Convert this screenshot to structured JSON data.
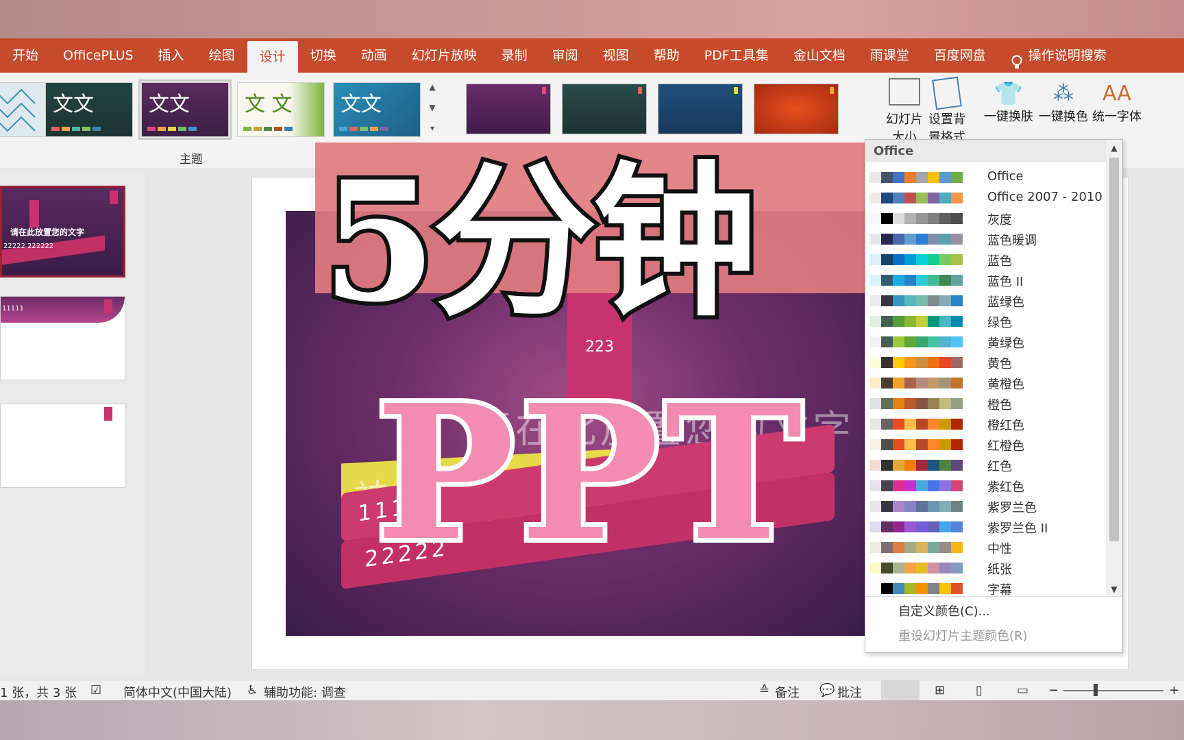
{
  "tabs": [
    "开始",
    "OfficePLUS",
    "插入",
    "绘图",
    "设计",
    "切换",
    "动画",
    "幻灯片放映",
    "录制",
    "审阅",
    "视图",
    "帮助",
    "PDF工具集",
    "金山文档",
    "雨课堂",
    "百度网盘"
  ],
  "active_tab": "设计",
  "tell_me": "操作说明搜索",
  "ribbon": {
    "theme_text": "文文",
    "theme_text_b": "文 文",
    "themes_group_label": "主题",
    "slide_size": "幻灯片大小",
    "format_bg": "设置背景格式",
    "one_click_skin": "一键换肤",
    "one_click_color": "一键换色",
    "unify_font": "统一字体"
  },
  "slide": {
    "pillar_text": "223",
    "title_text": "请在此放置您的文字",
    "yellow_text": "神州",
    "bar1_text": "1111",
    "bar2_text": "22222"
  },
  "thumbnails": {
    "t1_title": "请在此放置您的文字",
    "t1_sub": "22222 222222",
    "t2_text": "11111"
  },
  "overlay": {
    "headline": "5分钟",
    "ppt": "PPT"
  },
  "color_menu": {
    "header": "Office",
    "items": [
      {
        "name": "Office",
        "colors": [
          "#e8e8e8",
          "#44546a",
          "#4472c4",
          "#ed7d31",
          "#a5a5a5",
          "#ffc000",
          "#5b9bd5",
          "#70ad47"
        ]
      },
      {
        "name": "Office 2007 - 2010",
        "colors": [
          "#eeece1",
          "#1f497d",
          "#4f81bd",
          "#c0504d",
          "#9bbb59",
          "#8064a2",
          "#4bacc6",
          "#f79646"
        ]
      },
      {
        "name": "灰度",
        "colors": [
          "#f8f8f8",
          "#000000",
          "#dddddd",
          "#b2b2b2",
          "#969696",
          "#808080",
          "#5f5f5f",
          "#4d4d4d"
        ]
      },
      {
        "name": "蓝色暖调",
        "colors": [
          "#e7e6e6",
          "#242852",
          "#4a66ac",
          "#629dd1",
          "#297fd5",
          "#7f8fa9",
          "#5aa2ae",
          "#9d90a0"
        ]
      },
      {
        "name": "蓝色",
        "colors": [
          "#dbefF9",
          "#17406d",
          "#0f6fc6",
          "#009dd9",
          "#0bd0d9",
          "#10cf9b",
          "#7cca62",
          "#a5c249"
        ]
      },
      {
        "name": "蓝色 II",
        "colors": [
          "#dbf5f9",
          "#335b74",
          "#1cade4",
          "#2683c6",
          "#27ced7",
          "#42ba97",
          "#3e8853",
          "#62a39f"
        ]
      },
      {
        "name": "蓝绿色",
        "colors": [
          "#ebebeb",
          "#373545",
          "#3494ba",
          "#58b6c0",
          "#75bda7",
          "#7a8c8e",
          "#84acb6",
          "#2683c6"
        ]
      },
      {
        "name": "绿色",
        "colors": [
          "#e2efe2",
          "#455f51",
          "#549e39",
          "#8ab833",
          "#c0cf3a",
          "#029676",
          "#4ab5c4",
          "#0989b1"
        ]
      },
      {
        "name": "黄绿色",
        "colors": [
          "#f2f2f2",
          "#455f51",
          "#99cb38",
          "#63a537",
          "#37a76f",
          "#44c1a3",
          "#4eb3cf",
          "#51c3f9"
        ]
      },
      {
        "name": "黄色",
        "colors": [
          "#fffcdc",
          "#39302a",
          "#ffca08",
          "#f8931d",
          "#ce8d3e",
          "#ec7016",
          "#e64823",
          "#9c6a6a"
        ]
      },
      {
        "name": "黄橙色",
        "colors": [
          "#fbeec9",
          "#4e3b30",
          "#f0a22e",
          "#a5644e",
          "#b58b80",
          "#c3986d",
          "#a19574",
          "#c17529"
        ]
      },
      {
        "name": "橙色",
        "colors": [
          "#dfe3e5",
          "#637052",
          "#e48312",
          "#bd582c",
          "#865640",
          "#9b8357",
          "#c2bc80",
          "#94a088"
        ]
      },
      {
        "name": "橙红色",
        "colors": [
          "#e8e7e4",
          "#696464",
          "#e84c22",
          "#ffbd47",
          "#b64926",
          "#ff8427",
          "#cc9900",
          "#b22600"
        ]
      },
      {
        "name": "红橙色",
        "colors": [
          "#f9f1e6",
          "#505046",
          "#e84c22",
          "#ffbd47",
          "#b64926",
          "#ff8427",
          "#cc9900",
          "#b22600"
        ]
      },
      {
        "name": "红色",
        "colors": [
          "#f4dcd4",
          "#323232",
          "#e3aa3a",
          "#f07f09",
          "#9f2936",
          "#1b587c",
          "#4e8542",
          "#604878"
        ]
      },
      {
        "name": "紫红色",
        "colors": [
          "#e8e3ef",
          "#454551",
          "#e32d91",
          "#c830cc",
          "#4ea6dc",
          "#4775e7",
          "#8971e1",
          "#d54773"
        ]
      },
      {
        "name": "紫罗兰色",
        "colors": [
          "#eae5eb",
          "#373545",
          "#ad84c6",
          "#8784c7",
          "#5d739a",
          "#6997af",
          "#84acb6",
          "#6f8183"
        ]
      },
      {
        "name": "紫罗兰色 II",
        "colors": [
          "#dfdcee",
          "#632e62",
          "#92278f",
          "#9b57d3",
          "#755dd9",
          "#665eb8",
          "#45a5ed",
          "#5982db"
        ]
      },
      {
        "name": "中性",
        "colors": [
          "#eeece1",
          "#7f6f6f",
          "#dd8047",
          "#a5ab81",
          "#d8b25c",
          "#7ba79d",
          "#968c8c",
          "#f7b615"
        ]
      },
      {
        "name": "纸张",
        "colors": [
          "#fefac9",
          "#444d26",
          "#a5b592",
          "#f3a447",
          "#e7bc29",
          "#d092a7",
          "#9c85c0",
          "#809ec2"
        ]
      },
      {
        "name": "字幕",
        "colors": [
          "#ffffff",
          "#000000",
          "#418ab3",
          "#a6b727",
          "#f69200",
          "#838383",
          "#fec306",
          "#df5327"
        ]
      }
    ],
    "custom": "自定义颜色(C)...",
    "reset": "重设幻灯片主题颜色(R)"
  },
  "status": {
    "slide_count": "1 张，共 3 张",
    "language": "简体中文(中国大陆)",
    "accessibility": "辅助功能: 调查",
    "notes": "备注",
    "comments": "批注"
  }
}
